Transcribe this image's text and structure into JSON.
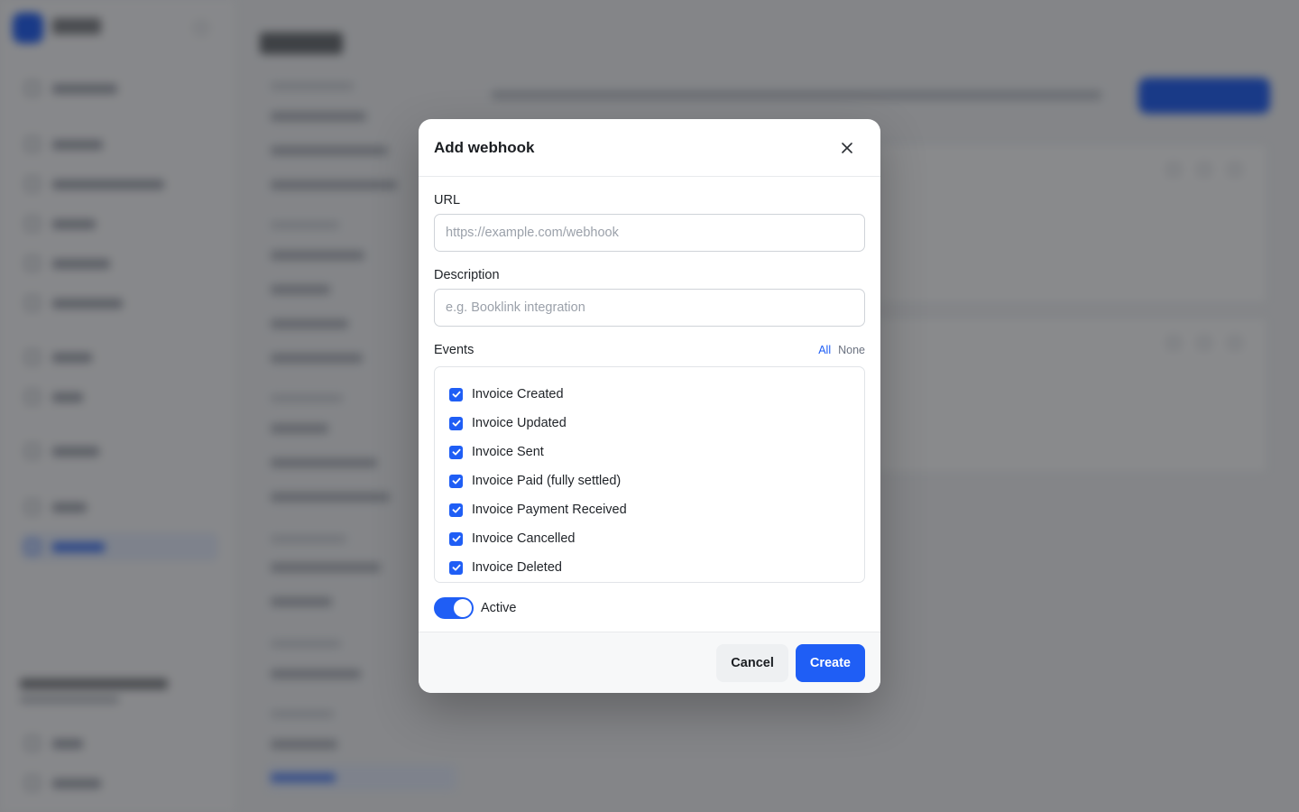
{
  "modal": {
    "title": "Add webhook",
    "close_icon": "close-icon"
  },
  "url": {
    "label": "URL",
    "value": "",
    "placeholder": "https://example.com/webhook"
  },
  "description": {
    "label": "Description",
    "value": "",
    "placeholder": "e.g. Booklink integration"
  },
  "events": {
    "label": "Events",
    "all_label": "All",
    "none_label": "None",
    "items": [
      {
        "label": "Invoice Created",
        "checked": true
      },
      {
        "label": "Invoice Updated",
        "checked": true
      },
      {
        "label": "Invoice Sent",
        "checked": true
      },
      {
        "label": "Invoice Paid (fully settled)",
        "checked": true
      },
      {
        "label": "Invoice Payment Received",
        "checked": true
      },
      {
        "label": "Invoice Cancelled",
        "checked": true
      },
      {
        "label": "Invoice Deleted",
        "checked": true
      }
    ]
  },
  "active": {
    "label": "Active",
    "on": true
  },
  "footer": {
    "cancel_label": "Cancel",
    "create_label": "Create"
  },
  "colors": {
    "accent": "#1f5ef5",
    "overlay": "rgba(20,22,26,0.5)"
  }
}
